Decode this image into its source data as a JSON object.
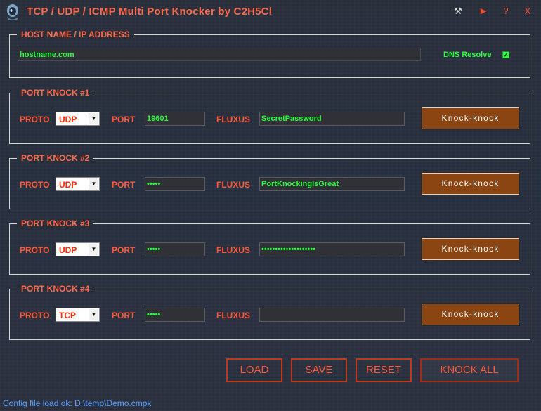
{
  "window": {
    "title": "TCP / UDP / ICMP Multi Port Knocker by C2H5Cl",
    "controls": {
      "hammer": "⚒",
      "play": "▶",
      "help": "?",
      "close": "X"
    }
  },
  "host": {
    "legend": "HOST NAME / IP ADDRESS",
    "value": "hostname.com",
    "dns_label": "DNS Resolve",
    "dns_checked": true
  },
  "knocks": [
    {
      "legend": "PORT KNOCK #1",
      "proto_label": "PROTO",
      "proto": "UDP",
      "port_label": "PORT",
      "port": "19601",
      "fluxus_label": "FLUXUS",
      "fluxus": "SecretPassword",
      "button": "Knock-knock"
    },
    {
      "legend": "PORT KNOCK #2",
      "proto_label": "PROTO",
      "proto": "UDP",
      "port_label": "PORT",
      "port": "•••••",
      "fluxus_label": "FLUXUS",
      "fluxus": "PortKnockingIsGreat",
      "button": "Knock-knock"
    },
    {
      "legend": "PORT KNOCK #3",
      "proto_label": "PROTO",
      "proto": "UDP",
      "port_label": "PORT",
      "port": "•••••",
      "fluxus_label": "FLUXUS",
      "fluxus": "••••••••••••••••••••",
      "button": "Knock-knock"
    },
    {
      "legend": "PORT KNOCK #4",
      "proto_label": "PROTO",
      "proto": "TCP",
      "port_label": "PORT",
      "port": "•••••",
      "fluxus_label": "FLUXUS",
      "fluxus": "",
      "button": "Knock-knock"
    }
  ],
  "actions": {
    "load": "LOAD",
    "save": "SAVE",
    "reset": "RESET",
    "knock_all": "KNOCK ALL"
  },
  "status": "Config file load ok: D:\\temp\\Demo.cmpk",
  "colors": {
    "accent": "#ff5a3c",
    "field_text": "#2aff3d",
    "button_bg": "#8a4513",
    "status": "#5aa0ff"
  }
}
